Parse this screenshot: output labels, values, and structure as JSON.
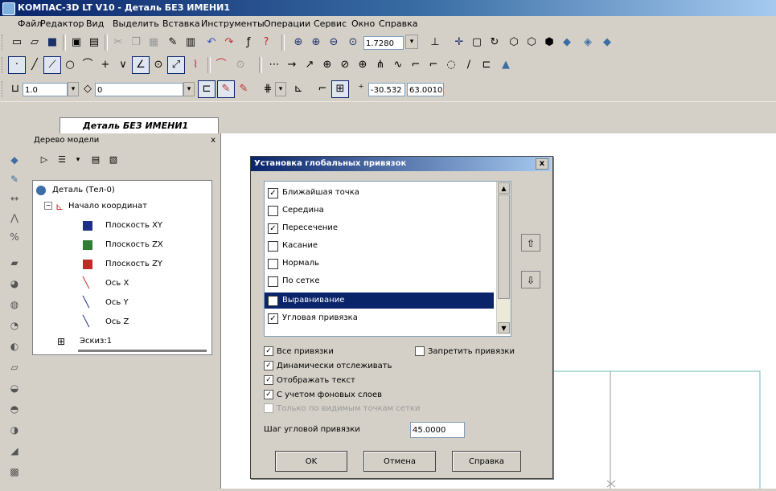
{
  "window": {
    "title": "КОМПАС-3D LT V10 - Деталь БЕЗ ИМЕНИ1"
  },
  "menu": [
    "Файл",
    "Редактор",
    "Вид",
    "Выделить",
    "Вставка",
    "Инструменты",
    "Операции",
    "Сервис",
    "Окно",
    "Справка"
  ],
  "toolbar": {
    "zoom_value": "1.7280",
    "line_width": "1.0",
    "layer": "0",
    "coord_x": "-30.532",
    "coord_y": "63.0010"
  },
  "doc_tab": {
    "label": "Деталь БЕЗ ИМЕНИ1"
  },
  "tree": {
    "header": "Дерево модели",
    "close": "x",
    "items": [
      {
        "label": "Деталь (Тел-0)",
        "icon": "part-icon"
      },
      {
        "label": "Начало координат",
        "icon": "origin-icon"
      },
      {
        "label": "Плоскость XY",
        "icon": "plane-icon"
      },
      {
        "label": "Плоскость ZX",
        "icon": "plane-icon"
      },
      {
        "label": "Плоскость ZY",
        "icon": "plane-icon"
      },
      {
        "label": "Ось X",
        "icon": "axis-icon"
      },
      {
        "label": "Ось Y",
        "icon": "axis-icon"
      },
      {
        "label": "Ось Z",
        "icon": "axis-icon"
      },
      {
        "label": "Эскиз:1",
        "icon": "sketch-icon"
      }
    ]
  },
  "dialog": {
    "title": "Установка глобальных привязок",
    "close": "x",
    "snaps": [
      {
        "label": "Ближайшая точка",
        "checked": true
      },
      {
        "label": "Середина",
        "checked": false
      },
      {
        "label": "Пересечение",
        "checked": true
      },
      {
        "label": "Касание",
        "checked": false
      },
      {
        "label": "Нормаль",
        "checked": false
      },
      {
        "label": "По сетке",
        "checked": false
      },
      {
        "label": "Выравнивание",
        "checked": true,
        "selected": true
      },
      {
        "label": "Угловая привязка",
        "checked": true
      }
    ],
    "options": [
      {
        "label": "Все привязки",
        "checked": true
      },
      {
        "label": "Запретить привязки",
        "checked": false
      },
      {
        "label": "Динамически отслеживать",
        "checked": true
      },
      {
        "label": "Отображать текст",
        "checked": true
      },
      {
        "label": "С учетом фоновых слоев",
        "checked": true
      },
      {
        "label": "Только по видимым точкам сетки",
        "checked": false,
        "disabled": true
      }
    ],
    "angle_label": "Шаг угловой привязки",
    "angle_value": "45.0000",
    "ok": "OK",
    "cancel": "Отмена",
    "help": "Справка"
  }
}
